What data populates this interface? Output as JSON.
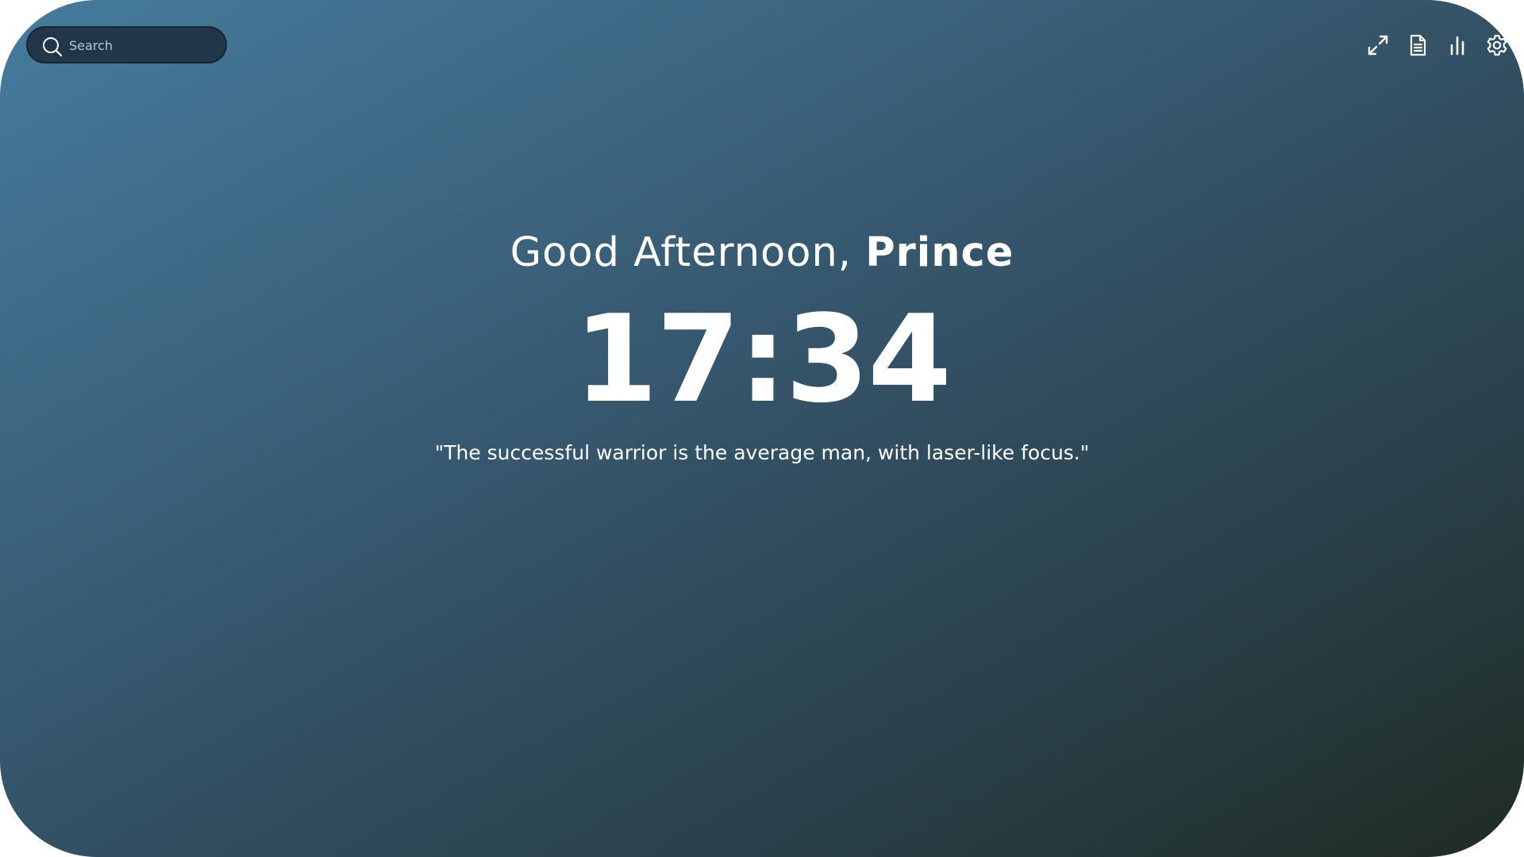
{
  "search": {
    "placeholder": "Search",
    "icon": "search-icon"
  },
  "toolbar": {
    "buttons": [
      {
        "name": "fullscreen",
        "icon": "expand-icon"
      },
      {
        "name": "notes",
        "icon": "document-icon"
      },
      {
        "name": "stats",
        "icon": "bar-chart-icon"
      },
      {
        "name": "settings",
        "icon": "gear-icon"
      }
    ]
  },
  "greeting": {
    "prefix": "Good Afternoon, ",
    "name": "Prince"
  },
  "clock": {
    "time": "17:34"
  },
  "quote": {
    "text": "\"The successful warrior is the average man, with laser-like focus.\""
  },
  "colors": {
    "gradient_start": "#457b9d",
    "gradient_end": "#202b22",
    "search_background": "#213648",
    "text": "#ffffff"
  }
}
